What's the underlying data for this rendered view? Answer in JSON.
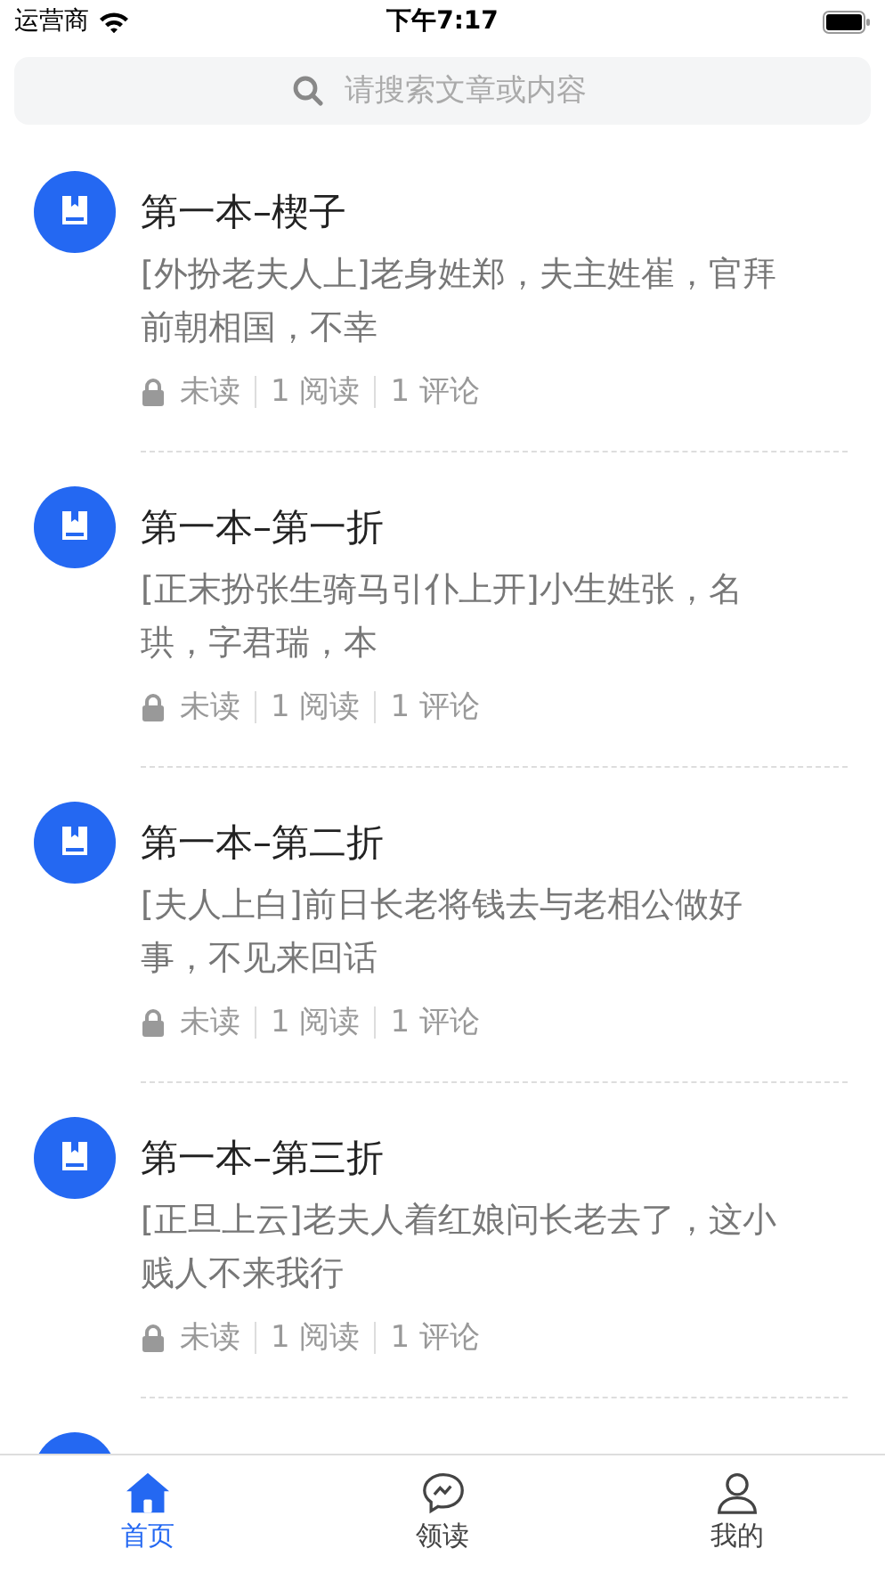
{
  "status_bar": {
    "carrier": "运营商",
    "time": "下午7:17"
  },
  "search": {
    "placeholder": "请搜索文章或内容"
  },
  "articles": [
    {
      "kind": "book",
      "title": "第一本–楔子",
      "excerpt": "[外扮老夫人上]老身姓郑，夫主姓崔，官拜前朝相国，不幸",
      "locked": true,
      "status": "未读",
      "reads": "1 阅读",
      "comments": "1 评论"
    },
    {
      "kind": "book",
      "title": "第一本–第一折",
      "excerpt": "[正末扮张生骑马引仆上开]小生姓张，名珙，字君瑞，本",
      "locked": true,
      "status": "未读",
      "reads": "1 阅读",
      "comments": "1 评论"
    },
    {
      "kind": "book",
      "title": "第一本–第二折",
      "excerpt": "[夫人上白]前日长老将钱去与老相公做好事，不见来回话",
      "locked": true,
      "status": "未读",
      "reads": "1 阅读",
      "comments": "1 评论"
    },
    {
      "kind": "book",
      "title": "第一本–第三折",
      "excerpt": "[正旦上云]老夫人着红娘问长老去了，这小贱人不来我行",
      "locked": true,
      "status": "未读",
      "reads": "1 阅读",
      "comments": "1 评论"
    },
    {
      "kind": "book"
    }
  ],
  "tab_bar": [
    {
      "kind": "home",
      "label": "首页",
      "selected": true
    },
    {
      "kind": "chat",
      "label": "领读",
      "selected": false
    },
    {
      "kind": "user",
      "label": "我的",
      "selected": false
    }
  ]
}
